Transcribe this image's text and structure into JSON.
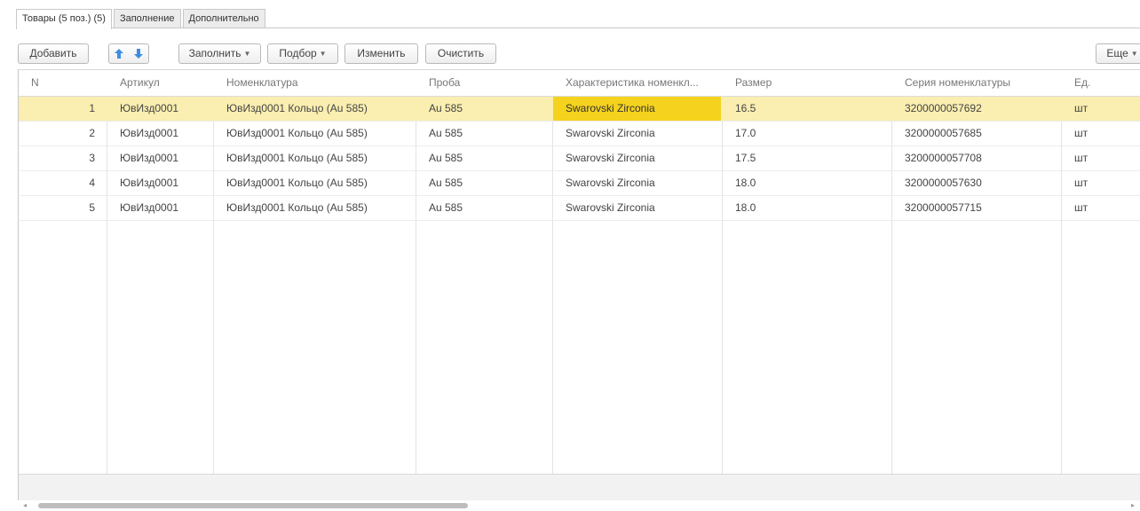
{
  "tabs": [
    {
      "label": "Товары (5 поз.) (5)"
    },
    {
      "label": "Заполнение"
    },
    {
      "label": "Дополнительно"
    }
  ],
  "toolbar": {
    "add_label": "Добавить",
    "fill_label": "Заполнить",
    "select_label": "Подбор",
    "edit_label": "Изменить",
    "clear_label": "Очистить",
    "more_label": "Еще",
    "icons": {
      "move_up": "arrow-up-icon",
      "move_down": "arrow-down-icon",
      "dropdown": "dropdown-caret-icon"
    }
  },
  "table": {
    "columns": [
      "N",
      "Артикул",
      "Номенклатура",
      "Проба",
      "Характеристика номенкл...",
      "Размер",
      "Серия номенклатуры",
      "Ед."
    ],
    "rows": [
      {
        "n": "1",
        "article": "ЮвИзд0001",
        "item": "ЮвИзд0001 Кольцо (Au 585)",
        "probe": "Au 585",
        "characteristic": "Swarovski Zirconia",
        "size": "16.5",
        "series": "3200000057692",
        "unit": "шт"
      },
      {
        "n": "2",
        "article": "ЮвИзд0001",
        "item": "ЮвИзд0001 Кольцо (Au 585)",
        "probe": "Au 585",
        "characteristic": "Swarovski Zirconia",
        "size": "17.0",
        "series": "3200000057685",
        "unit": "шт"
      },
      {
        "n": "3",
        "article": "ЮвИзд0001",
        "item": "ЮвИзд0001 Кольцо (Au 585)",
        "probe": "Au 585",
        "characteristic": "Swarovski Zirconia",
        "size": "17.5",
        "series": "3200000057708",
        "unit": "шт"
      },
      {
        "n": "4",
        "article": "ЮвИзд0001",
        "item": "ЮвИзд0001 Кольцо (Au 585)",
        "probe": "Au 585",
        "characteristic": "Swarovski Zirconia",
        "size": "18.0",
        "series": "3200000057630",
        "unit": "шт"
      },
      {
        "n": "5",
        "article": "ЮвИзд0001",
        "item": "ЮвИзд0001 Кольцо (Au 585)",
        "probe": "Au 585",
        "characteristic": "Swarovski Zirconia",
        "size": "18.0",
        "series": "3200000057715",
        "unit": "шт"
      }
    ]
  },
  "colors": {
    "selected_row": "#faeeb0",
    "current_cell": "#f5d21e",
    "arrow_blue": "#3b8ee0"
  }
}
